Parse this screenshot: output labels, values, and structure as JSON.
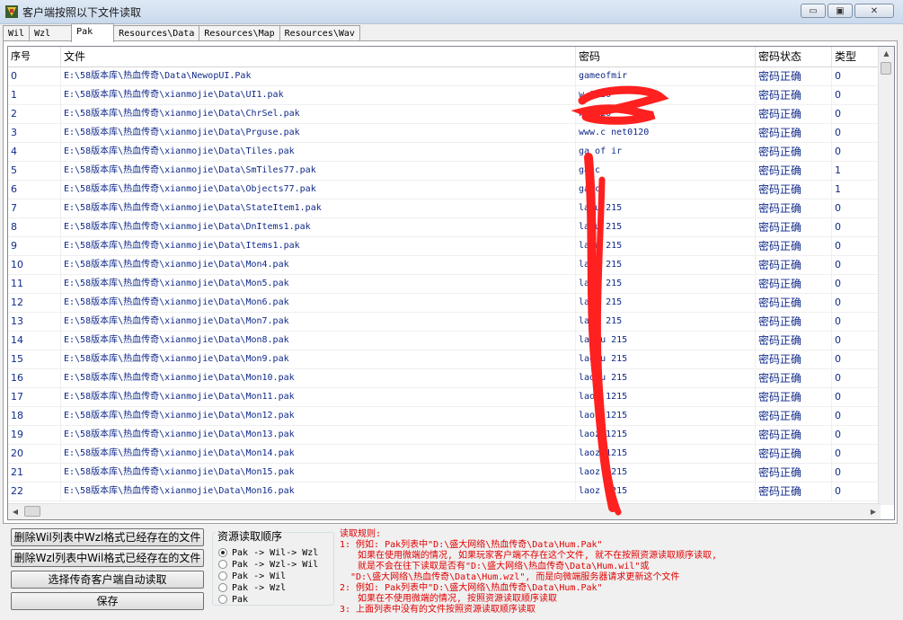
{
  "window": {
    "title": "客户端按照以下文件读取"
  },
  "tabs": [
    {
      "label": "Wil",
      "active": false
    },
    {
      "label": "Wzl",
      "active": false
    },
    {
      "label": "Pak",
      "active": true
    },
    {
      "label": "Resources\\Data",
      "active": false
    },
    {
      "label": "Resources\\Map",
      "active": false
    },
    {
      "label": "Resources\\Wav",
      "active": false
    }
  ],
  "table": {
    "columns": [
      "序号",
      "文件",
      "密码",
      "密码状态",
      "类型"
    ],
    "rows": [
      {
        "index": "0",
        "file": "E:\\58版本库\\热血传奇\\Data\\NewopUI.Pak",
        "password": "gameofmir",
        "status": "密码正确",
        "type": "0"
      },
      {
        "index": "1",
        "file": "E:\\58版本库\\热血传奇\\xianmojie\\Data\\UI1.pak",
        "password": "w  0120",
        "status": "密码正确",
        "type": "0"
      },
      {
        "index": "2",
        "file": "E:\\58版本库\\热血传奇\\xianmojie\\Data\\ChrSel.pak",
        "password": "w  0120",
        "status": "密码正确",
        "type": "0"
      },
      {
        "index": "3",
        "file": "E:\\58版本库\\热血传奇\\xianmojie\\Data\\Prguse.pak",
        "password": "www.c   net0120",
        "status": "密码正确",
        "type": "0"
      },
      {
        "index": "4",
        "file": "E:\\58版本库\\热血传奇\\xianmojie\\Data\\Tiles.pak",
        "password": "ga  of  ir",
        "status": "密码正确",
        "type": "0"
      },
      {
        "index": "5",
        "file": "E:\\58版本库\\热血传奇\\xianmojie\\Data\\SmTiles77.pak",
        "password": "ga   c",
        "status": "密码正确",
        "type": "1"
      },
      {
        "index": "6",
        "file": "E:\\58版本库\\热血传奇\\xianmojie\\Data\\Objects77.pak",
        "password": "ga   c",
        "status": "密码正确",
        "type": "1"
      },
      {
        "index": "7",
        "file": "E:\\58版本库\\热血传奇\\xianmojie\\Data\\StateItem1.pak",
        "password": "la  u 215",
        "status": "密码正确",
        "type": "0"
      },
      {
        "index": "8",
        "file": "E:\\58版本库\\热血传奇\\xianmojie\\Data\\DnItems1.pak",
        "password": "la  u 215",
        "status": "密码正确",
        "type": "0"
      },
      {
        "index": "9",
        "file": "E:\\58版本库\\热血传奇\\xianmojie\\Data\\Items1.pak",
        "password": "la  u 215",
        "status": "密码正确",
        "type": "0"
      },
      {
        "index": "10",
        "file": "E:\\58版本库\\热血传奇\\xianmojie\\Data\\Mon4.pak",
        "password": "la  u 215",
        "status": "密码正确",
        "type": "0"
      },
      {
        "index": "11",
        "file": "E:\\58版本库\\热血传奇\\xianmojie\\Data\\Mon5.pak",
        "password": "la  u 215",
        "status": "密码正确",
        "type": "0"
      },
      {
        "index": "12",
        "file": "E:\\58版本库\\热血传奇\\xianmojie\\Data\\Mon6.pak",
        "password": "la  u 215",
        "status": "密码正确",
        "type": "0"
      },
      {
        "index": "13",
        "file": "E:\\58版本库\\热血传奇\\xianmojie\\Data\\Mon7.pak",
        "password": "la  u 215",
        "status": "密码正确",
        "type": "0"
      },
      {
        "index": "14",
        "file": "E:\\58版本库\\热血传奇\\xianmojie\\Data\\Mon8.pak",
        "password": "la  hu 215",
        "status": "密码正确",
        "type": "0"
      },
      {
        "index": "15",
        "file": "E:\\58版本库\\热血传奇\\xianmojie\\Data\\Mon9.pak",
        "password": "lao  u 215",
        "status": "密码正确",
        "type": "0"
      },
      {
        "index": "16",
        "file": "E:\\58版本库\\热血传奇\\xianmojie\\Data\\Mon10.pak",
        "password": "lao  u 215",
        "status": "密码正确",
        "type": "0"
      },
      {
        "index": "17",
        "file": "E:\\58版本库\\热血传奇\\xianmojie\\Data\\Mon11.pak",
        "password": "laoz  1215",
        "status": "密码正确",
        "type": "0"
      },
      {
        "index": "18",
        "file": "E:\\58版本库\\热血传奇\\xianmojie\\Data\\Mon12.pak",
        "password": "laoz  1215",
        "status": "密码正确",
        "type": "0"
      },
      {
        "index": "19",
        "file": "E:\\58版本库\\热血传奇\\xianmojie\\Data\\Mon13.pak",
        "password": "laoz  1215",
        "status": "密码正确",
        "type": "0"
      },
      {
        "index": "20",
        "file": "E:\\58版本库\\热血传奇\\xianmojie\\Data\\Mon14.pak",
        "password": "laoz  1215",
        "status": "密码正确",
        "type": "0"
      },
      {
        "index": "21",
        "file": "E:\\58版本库\\热血传奇\\xianmojie\\Data\\Mon15.pak",
        "password": "laoz  1215",
        "status": "密码正确",
        "type": "0"
      },
      {
        "index": "22",
        "file": "E:\\58版本库\\热血传奇\\xianmojie\\Data\\Mon16.pak",
        "password": "laoz  1215",
        "status": "密码正确",
        "type": "0"
      }
    ]
  },
  "buttons": {
    "delete_wil": "删除Wil列表中Wzl格式已经存在的文件",
    "delete_wzl": "删除Wzl列表中Wil格式已经存在的文件",
    "auto_read": "选择传奇客户端自动读取",
    "save": "保存"
  },
  "read_order": {
    "title": "资源读取顺序",
    "options": [
      {
        "label": "Pak -> Wil-> Wzl",
        "checked": true
      },
      {
        "label": "Pak -> Wzl-> Wil",
        "checked": false
      },
      {
        "label": "Pak -> Wil",
        "checked": false
      },
      {
        "label": "Pak -> Wzl",
        "checked": false
      },
      {
        "label": "Pak",
        "checked": false
      }
    ]
  },
  "rules": {
    "lines": [
      "读取规则:",
      "1: 例如: Pak列表中\"D:\\盛大网络\\热血传奇\\Data\\Hum.Pak\"",
      "如果在使用微端的情况, 如果玩家客户端不存在这个文件, 就不在按照资源读取顺序读取,",
      "就是不会在往下读取是否有\"D:\\盛大网络\\热血传奇\\Data\\Hum.wil\"或",
      "\"D:\\盛大网络\\热血传奇\\Data\\Hum.wzl\", 而是向微端服务器请求更新这个文件",
      "2: 例如: Pak列表中\"D:\\盛大网络\\热血传奇\\Data\\Hum.Pak\"",
      "如果在不使用微端的情况, 按照资源读取顺序读取",
      "3: 上面列表中没有的文件按照资源读取顺序读取"
    ]
  },
  "colors": {
    "rules_text": "#e00000",
    "cell_text": "#102a8a"
  }
}
